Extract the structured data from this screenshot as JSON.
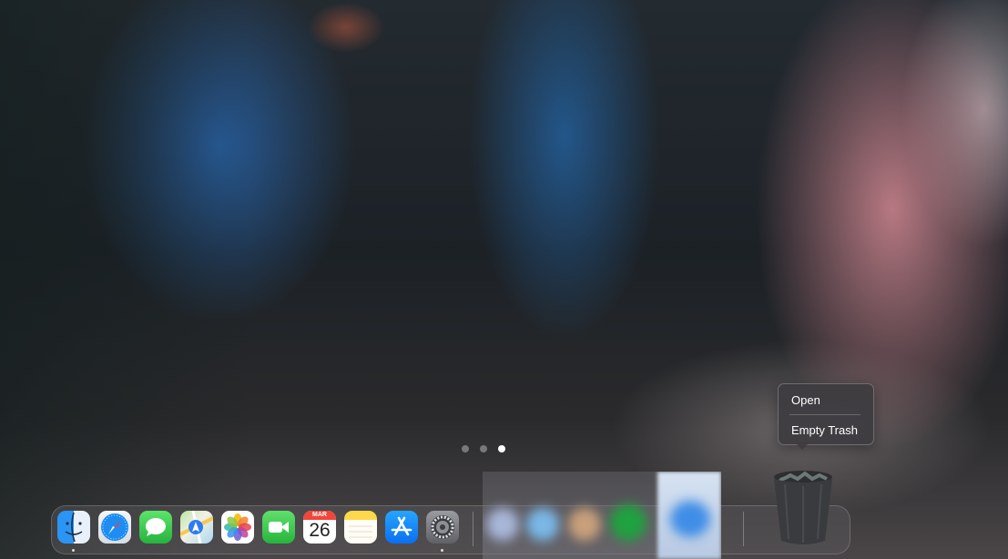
{
  "page_indicator": {
    "count": 3,
    "active_index": 2
  },
  "dock": {
    "apps": [
      {
        "name": "Finder",
        "icon": "finder-icon",
        "running": true
      },
      {
        "name": "Safari",
        "icon": "safari-icon",
        "running": false
      },
      {
        "name": "Messages",
        "icon": "messages-icon",
        "running": false
      },
      {
        "name": "Maps",
        "icon": "maps-icon",
        "running": false
      },
      {
        "name": "Photos",
        "icon": "photos-icon",
        "running": false
      },
      {
        "name": "FaceTime",
        "icon": "facetime-icon",
        "running": false
      },
      {
        "name": "Calendar",
        "icon": "calendar-icon",
        "running": false
      },
      {
        "name": "Notes",
        "icon": "notes-icon",
        "running": false
      },
      {
        "name": "App Store",
        "icon": "app-store-icon",
        "running": false
      },
      {
        "name": "System Settings",
        "icon": "settings-icon",
        "running": true
      }
    ],
    "calendar": {
      "month": "MAR",
      "day": "26"
    }
  },
  "context_menu": {
    "items": [
      {
        "label": "Open"
      },
      {
        "label": "Empty Trash"
      }
    ]
  },
  "colors": {
    "finder_blue": "#1e8ef5",
    "messages_green": "#34c759",
    "calendar_red": "#f2463a",
    "app_store_blue": "#1a8cff"
  }
}
